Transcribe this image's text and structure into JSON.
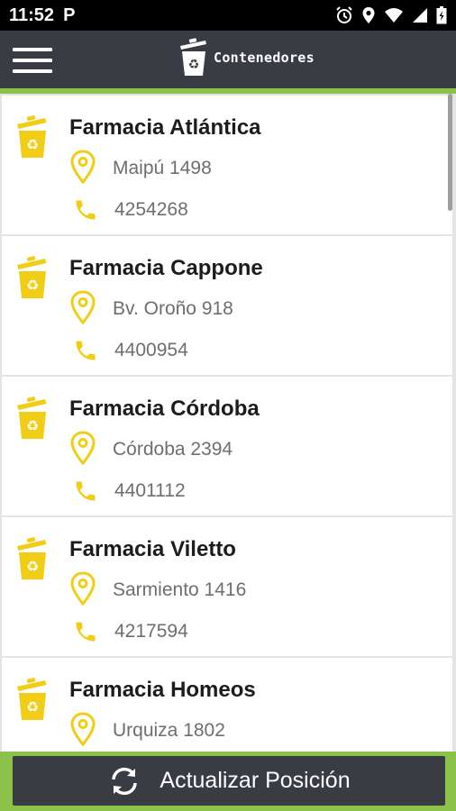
{
  "status_bar": {
    "time": "11:52",
    "app_indicator": "P",
    "icons": [
      "alarm-icon",
      "location-icon",
      "wifi-icon",
      "signal-icon",
      "battery-icon"
    ]
  },
  "app_bar": {
    "title": "Contenedores",
    "menu_icon": "hamburger-menu-icon",
    "logo_icon": "recycle-bin-icon"
  },
  "colors": {
    "accent": "#8bc34a",
    "toolbar": "#3a3c43",
    "icon_yellow": "#f2cd16"
  },
  "items": [
    {
      "name": "Farmacia Atlántica",
      "address": "Maipú 1498",
      "phone": "4254268"
    },
    {
      "name": "Farmacia Cappone",
      "address": "Bv. Oroño 918",
      "phone": "4400954"
    },
    {
      "name": "Farmacia Córdoba",
      "address": "Córdoba 2394",
      "phone": "4401112"
    },
    {
      "name": "Farmacia Viletto",
      "address": "Sarmiento 1416",
      "phone": "4217594"
    },
    {
      "name": "Farmacia Homeos",
      "address": "Urquiza 1802",
      "phone": ""
    }
  ],
  "bottom_button": {
    "label": "Actualizar Posición",
    "icon": "refresh-icon"
  }
}
